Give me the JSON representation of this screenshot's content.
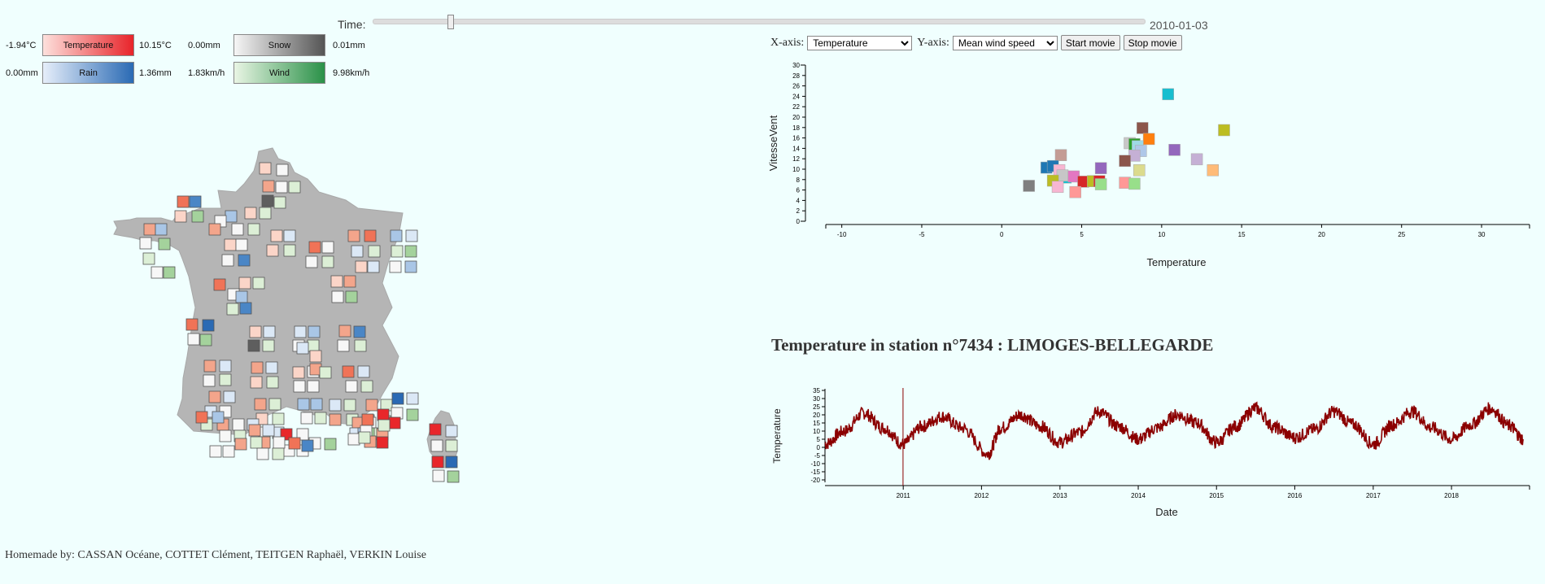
{
  "time": {
    "label": "Time:",
    "value": "2010-01-03",
    "position": 0.1
  },
  "legend": {
    "temperature": {
      "min": "-1.94°C",
      "label": "Temperature",
      "max": "10.15°C"
    },
    "rain": {
      "min": "0.00mm",
      "label": "Rain",
      "max": "1.36mm"
    },
    "snow": {
      "min": "0.00mm",
      "label": "Snow",
      "max": "0.01mm"
    },
    "wind": {
      "min": "1.83km/h",
      "label": "Wind",
      "max": "9.98km/h"
    }
  },
  "controls": {
    "x_axis_label": "X-axis:",
    "x_axis_value": "Temperature",
    "y_axis_label": "Y-axis:",
    "y_axis_value": "Mean wind speed",
    "start_label": "Start movie",
    "stop_label": "Stop movie"
  },
  "timeseries_title": "Temperature in station n°7434 : LIMOGES-BELLEGARDE",
  "footer": "Homemade by: CASSAN Océane, COTTET Clément, TEITGEN Raphaël, VERKIN Louise",
  "chart_data": [
    {
      "type": "scatter",
      "xlabel": "Temperature",
      "ylabel": "VitesseVent",
      "xlim": [
        -11,
        33
      ],
      "ylim": [
        0,
        30
      ],
      "x_ticks": [
        -10,
        -5,
        0,
        5,
        10,
        15,
        20,
        25,
        30
      ],
      "y_ticks": [
        0,
        2,
        4,
        6,
        8,
        10,
        12,
        14,
        16,
        18,
        20,
        22,
        24,
        26,
        28,
        30
      ],
      "points": [
        {
          "x": 10.4,
          "y": 24.4,
          "color": "#17becf"
        },
        {
          "x": 13.9,
          "y": 17.5,
          "color": "#bcbd22"
        },
        {
          "x": 8.8,
          "y": 17.9,
          "color": "#8c564b"
        },
        {
          "x": 9.2,
          "y": 15.8,
          "color": "#ff7f0e"
        },
        {
          "x": 8.0,
          "y": 15.0,
          "color": "#c7c7c7"
        },
        {
          "x": 8.3,
          "y": 14.8,
          "color": "#2ca02c"
        },
        {
          "x": 8.5,
          "y": 14.4,
          "color": "#9edae5"
        },
        {
          "x": 8.7,
          "y": 13.5,
          "color": "#aec7e8"
        },
        {
          "x": 10.8,
          "y": 13.7,
          "color": "#9467bd"
        },
        {
          "x": 8.3,
          "y": 12.6,
          "color": "#c5b0d5"
        },
        {
          "x": 7.7,
          "y": 11.6,
          "color": "#8c564b"
        },
        {
          "x": 12.2,
          "y": 11.9,
          "color": "#c5b0d5"
        },
        {
          "x": 13.2,
          "y": 9.8,
          "color": "#ffbb78"
        },
        {
          "x": 8.6,
          "y": 9.8,
          "color": "#dbdb8d"
        },
        {
          "x": 3.7,
          "y": 12.7,
          "color": "#c49c94"
        },
        {
          "x": 2.8,
          "y": 10.3,
          "color": "#1f77b4"
        },
        {
          "x": 3.2,
          "y": 10.6,
          "color": "#1f77b4"
        },
        {
          "x": 3.6,
          "y": 9.8,
          "color": "#f7b6d2"
        },
        {
          "x": 6.2,
          "y": 10.2,
          "color": "#9467bd"
        },
        {
          "x": 4.0,
          "y": 8.4,
          "color": "#17becf"
        },
        {
          "x": 3.8,
          "y": 8.8,
          "color": "#c7c7c7"
        },
        {
          "x": 4.5,
          "y": 8.6,
          "color": "#e377c2"
        },
        {
          "x": 3.2,
          "y": 7.8,
          "color": "#bcbd22"
        },
        {
          "x": 5.1,
          "y": 7.6,
          "color": "#d62728"
        },
        {
          "x": 5.7,
          "y": 7.7,
          "color": "#bcbd22"
        },
        {
          "x": 6.1,
          "y": 7.7,
          "color": "#d62728"
        },
        {
          "x": 6.2,
          "y": 7.1,
          "color": "#98df8a"
        },
        {
          "x": 7.7,
          "y": 7.4,
          "color": "#ff9896"
        },
        {
          "x": 8.3,
          "y": 7.2,
          "color": "#98df8a"
        },
        {
          "x": 3.5,
          "y": 6.6,
          "color": "#f7b6d2"
        },
        {
          "x": 4.6,
          "y": 5.6,
          "color": "#ff9896"
        },
        {
          "x": 1.7,
          "y": 6.8,
          "color": "#7f7f7f"
        }
      ]
    },
    {
      "type": "line",
      "xlabel": "Date",
      "ylabel": "Temperature",
      "ylim": [
        -20,
        35
      ],
      "y_ticks": [
        -20,
        -15,
        -10,
        -5,
        0,
        5,
        10,
        15,
        20,
        25,
        30,
        35
      ],
      "x_ticks": [
        "2011",
        "2012",
        "2013",
        "2014",
        "2015",
        "2016",
        "2017",
        "2018"
      ],
      "x_range": [
        "2010-01-01",
        "2018-12-31"
      ],
      "marker_date": "2010-12-31",
      "series": [
        {
          "color": "#8b0000",
          "x": [
            "2010-01",
            "2010-04",
            "2010-07",
            "2010-10",
            "2011-01",
            "2011-04",
            "2011-07",
            "2011-10",
            "2012-02",
            "2012-04",
            "2012-07",
            "2012-10",
            "2013-01",
            "2013-04",
            "2013-07",
            "2013-10",
            "2014-01",
            "2014-04",
            "2014-07",
            "2014-10",
            "2015-01",
            "2015-04",
            "2015-07",
            "2015-10",
            "2016-01",
            "2016-04",
            "2016-07",
            "2016-10",
            "2017-01",
            "2017-04",
            "2017-07",
            "2017-10",
            "2018-01",
            "2018-04",
            "2018-07",
            "2018-10",
            "2018-12"
          ],
          "values": [
            2,
            10,
            21,
            12,
            2,
            13,
            19,
            12,
            -4,
            12,
            20,
            13,
            3,
            9,
            22,
            13,
            5,
            12,
            20,
            15,
            3,
            13,
            24,
            12,
            6,
            11,
            22,
            14,
            2,
            14,
            22,
            12,
            5,
            14,
            24,
            13,
            5
          ]
        }
      ]
    }
  ]
}
